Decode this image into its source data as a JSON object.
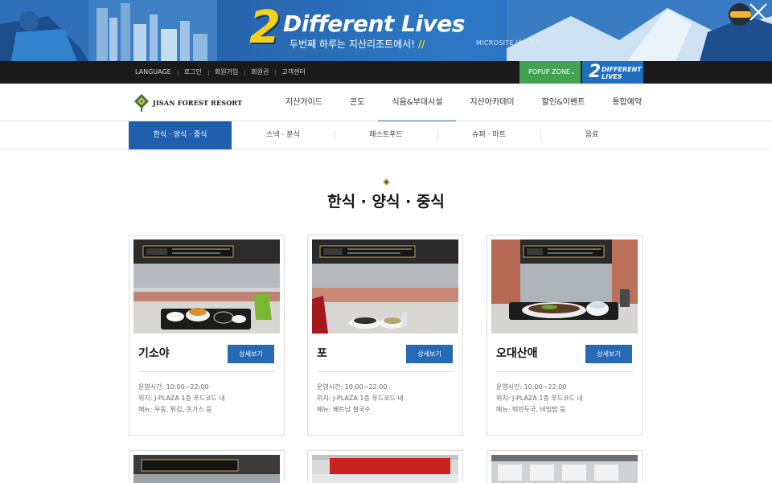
{
  "banner": {
    "big_number": "2",
    "headline": "Different Lives",
    "subline": "두번째 하루는 지산리조트에서!",
    "microsite": "MICROSITE 바로가기  ›",
    "close_icon": "close-icon"
  },
  "util_menu": [
    "LANGUAGE",
    "로그인",
    "회원가입",
    "회원권",
    "고객센터"
  ],
  "popup_zone": {
    "label": "POPUP ZONE",
    "chevron": "⌄"
  },
  "two_lives": {
    "n": "2",
    "t1": "DIFFERENT",
    "t2": "LIVES"
  },
  "logo": {
    "text": "JISAN FOREST RESORT"
  },
  "gnb": [
    "지산가이드",
    "콘도",
    "식음&부대시설",
    "지산아카데미",
    "할인&이벤트",
    "통합예약"
  ],
  "gnb_active_index": 2,
  "subtabs": [
    "한식 · 양식 · 중식",
    "스낵 · 분식",
    "패스트푸드",
    "슈퍼 · 마트",
    "음료"
  ],
  "section_title": "한식 · 양식 · 중식",
  "cards": [
    {
      "name": "기소야",
      "button": "상세보기",
      "hours": "운영시간: 10:00~22:00",
      "location": "위치: J-PLAZA 1층 푸드코드 내",
      "menu": "메뉴: 우동, 튀김, 돈가스 등"
    },
    {
      "name": "포",
      "button": "상세보기",
      "hours": "운영시간: 10:00~22:00",
      "location": "위치: J-PLAZA 1층 푸드코드 내",
      "menu": "메뉴: 베트남 쌀국수"
    },
    {
      "name": "오대산애",
      "button": "상세보기",
      "hours": "운영시간: 10:00~22:00",
      "location": "위치: J-PLAZA 1층 푸드코드 내",
      "menu": "메뉴: 떡만두국, 비빔밥 등"
    }
  ],
  "colors": {
    "accent": "#1f5fae",
    "button": "#2669b4",
    "popup": "#43a352",
    "banner": "#2a6cb6"
  }
}
